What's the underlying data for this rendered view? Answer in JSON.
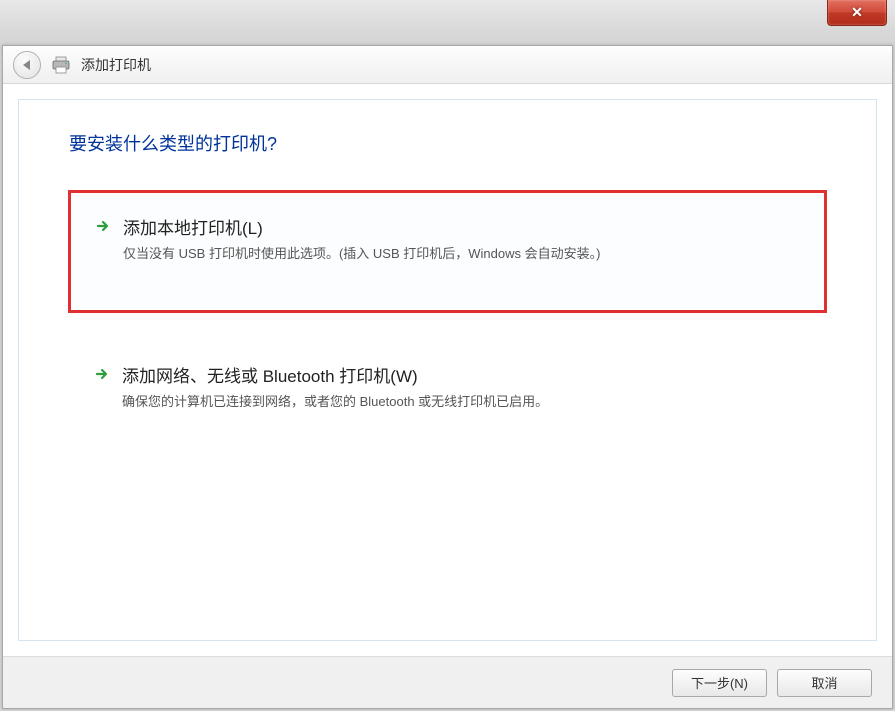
{
  "header": {
    "title": "添加打印机"
  },
  "main": {
    "heading": "要安装什么类型的打印机?",
    "options": [
      {
        "title": "添加本地打印机(L)",
        "description": "仅当没有 USB 打印机时使用此选项。(插入 USB 打印机后，Windows 会自动安装。)"
      },
      {
        "title": "添加网络、无线或 Bluetooth 打印机(W)",
        "description": "确保您的计算机已连接到网络，或者您的 Bluetooth 或无线打印机已启用。"
      }
    ]
  },
  "buttons": {
    "next": "下一步(N)",
    "cancel": "取消"
  },
  "colors": {
    "heading": "#003399",
    "highlight": "#e03030",
    "close_bg": "#c13926"
  }
}
